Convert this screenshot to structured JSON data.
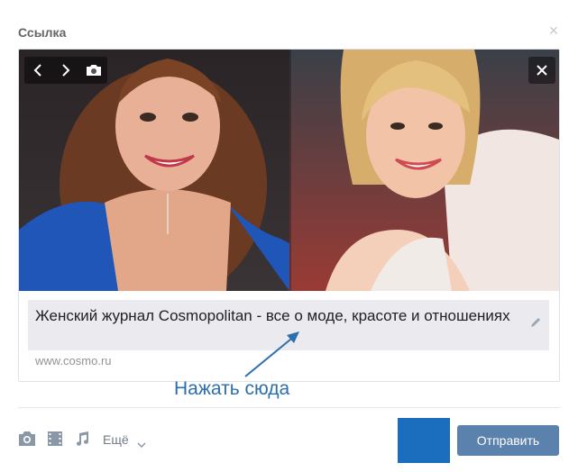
{
  "dialog": {
    "title": "Ссылка",
    "close_icon": "close-icon"
  },
  "preview": {
    "controls": [
      "chevron-left-icon",
      "chevron-right-icon",
      "camera-icon"
    ],
    "remove_icon": "close-icon",
    "title": "Женский журнал Cosmopolitan - все о моде, красоте и отношениях",
    "url": "www.cosmo.ru",
    "edit_icon": "pencil-icon"
  },
  "annotation": {
    "text": "Нажать сюда"
  },
  "toolbar": {
    "icons": [
      "camera-icon",
      "film-icon",
      "music-note-icon"
    ],
    "more_label": "Ещё",
    "send_label": "Отправить"
  },
  "colors": {
    "accent_blue": "#1a6ebd",
    "button_blue": "#5b82ac",
    "annotation_blue": "#2d6fae",
    "link_title_bg": "#eaeaef"
  }
}
